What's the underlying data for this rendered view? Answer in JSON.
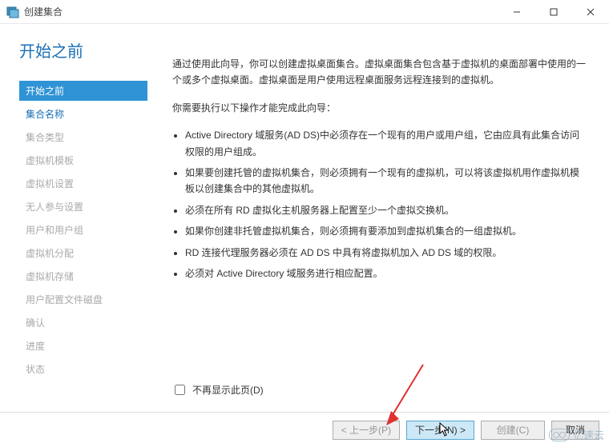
{
  "window": {
    "title": "创建集合"
  },
  "heading": "开始之前",
  "nav": [
    {
      "label": "开始之前",
      "state": "active"
    },
    {
      "label": "集合名称",
      "state": "enabled"
    },
    {
      "label": "集合类型",
      "state": "disabled"
    },
    {
      "label": "虚拟机模板",
      "state": "disabled"
    },
    {
      "label": "虚拟机设置",
      "state": "disabled"
    },
    {
      "label": "无人参与设置",
      "state": "disabled"
    },
    {
      "label": "用户和用户组",
      "state": "disabled"
    },
    {
      "label": "虚拟机分配",
      "state": "disabled"
    },
    {
      "label": "虚拟机存储",
      "state": "disabled"
    },
    {
      "label": "用户配置文件磁盘",
      "state": "disabled"
    },
    {
      "label": "确认",
      "state": "disabled"
    },
    {
      "label": "进度",
      "state": "disabled"
    },
    {
      "label": "状态",
      "state": "disabled"
    }
  ],
  "body": {
    "intro": "通过使用此向导，你可以创建虚拟桌面集合。虚拟桌面集合包含基于虚拟机的桌面部署中使用的一个或多个虚拟桌面。虚拟桌面是用户使用远程桌面服务远程连接到的虚拟机。",
    "must": "你需要执行以下操作才能完成此向导：",
    "bullets": [
      "Active Directory 域服务(AD DS)中必须存在一个现有的用户或用户组，它由应具有此集合访问权限的用户组成。",
      "如果要创建托管的虚拟机集合，则必须拥有一个现有的虚拟机，可以将该虚拟机用作虚拟机模板以创建集合中的其他虚拟机。",
      "必须在所有 RD 虚拟化主机服务器上配置至少一个虚拟交换机。",
      "如果你创建非托管虚拟机集合，则必须拥有要添加到虚拟机集合的一组虚拟机。",
      "RD 连接代理服务器必须在 AD DS 中具有将虚拟机加入 AD DS 域的权限。",
      "必须对 Active Directory 域服务进行相应配置。"
    ]
  },
  "checkbox": {
    "label": "不再显示此页(D)"
  },
  "buttons": {
    "prev": "< 上一步(P)",
    "next": "下一步(N) >",
    "create": "创建(C)",
    "cancel": "取消"
  },
  "watermark": "亿速云"
}
